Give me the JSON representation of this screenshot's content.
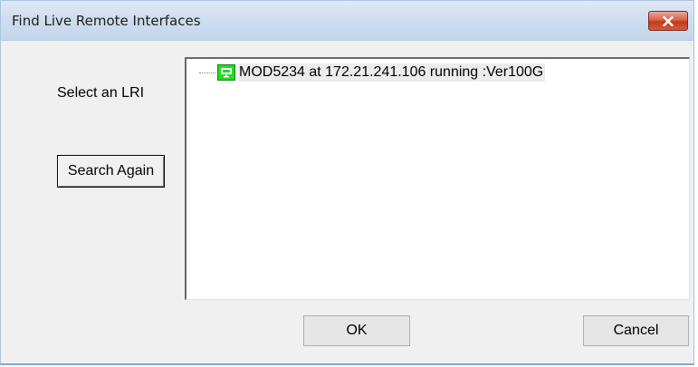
{
  "window": {
    "title": "Find Live Remote Interfaces",
    "close_icon": "close-icon"
  },
  "body": {
    "prompt_label": "Select an LRI",
    "search_button_label": "Search Again"
  },
  "tree": {
    "items": [
      {
        "icon": "network-device-icon",
        "icon_color": "#22dd22",
        "label": "MOD5234  at 172.21.241.106 running :Ver100G"
      }
    ]
  },
  "footer": {
    "ok_label": "OK",
    "cancel_label": "Cancel"
  }
}
